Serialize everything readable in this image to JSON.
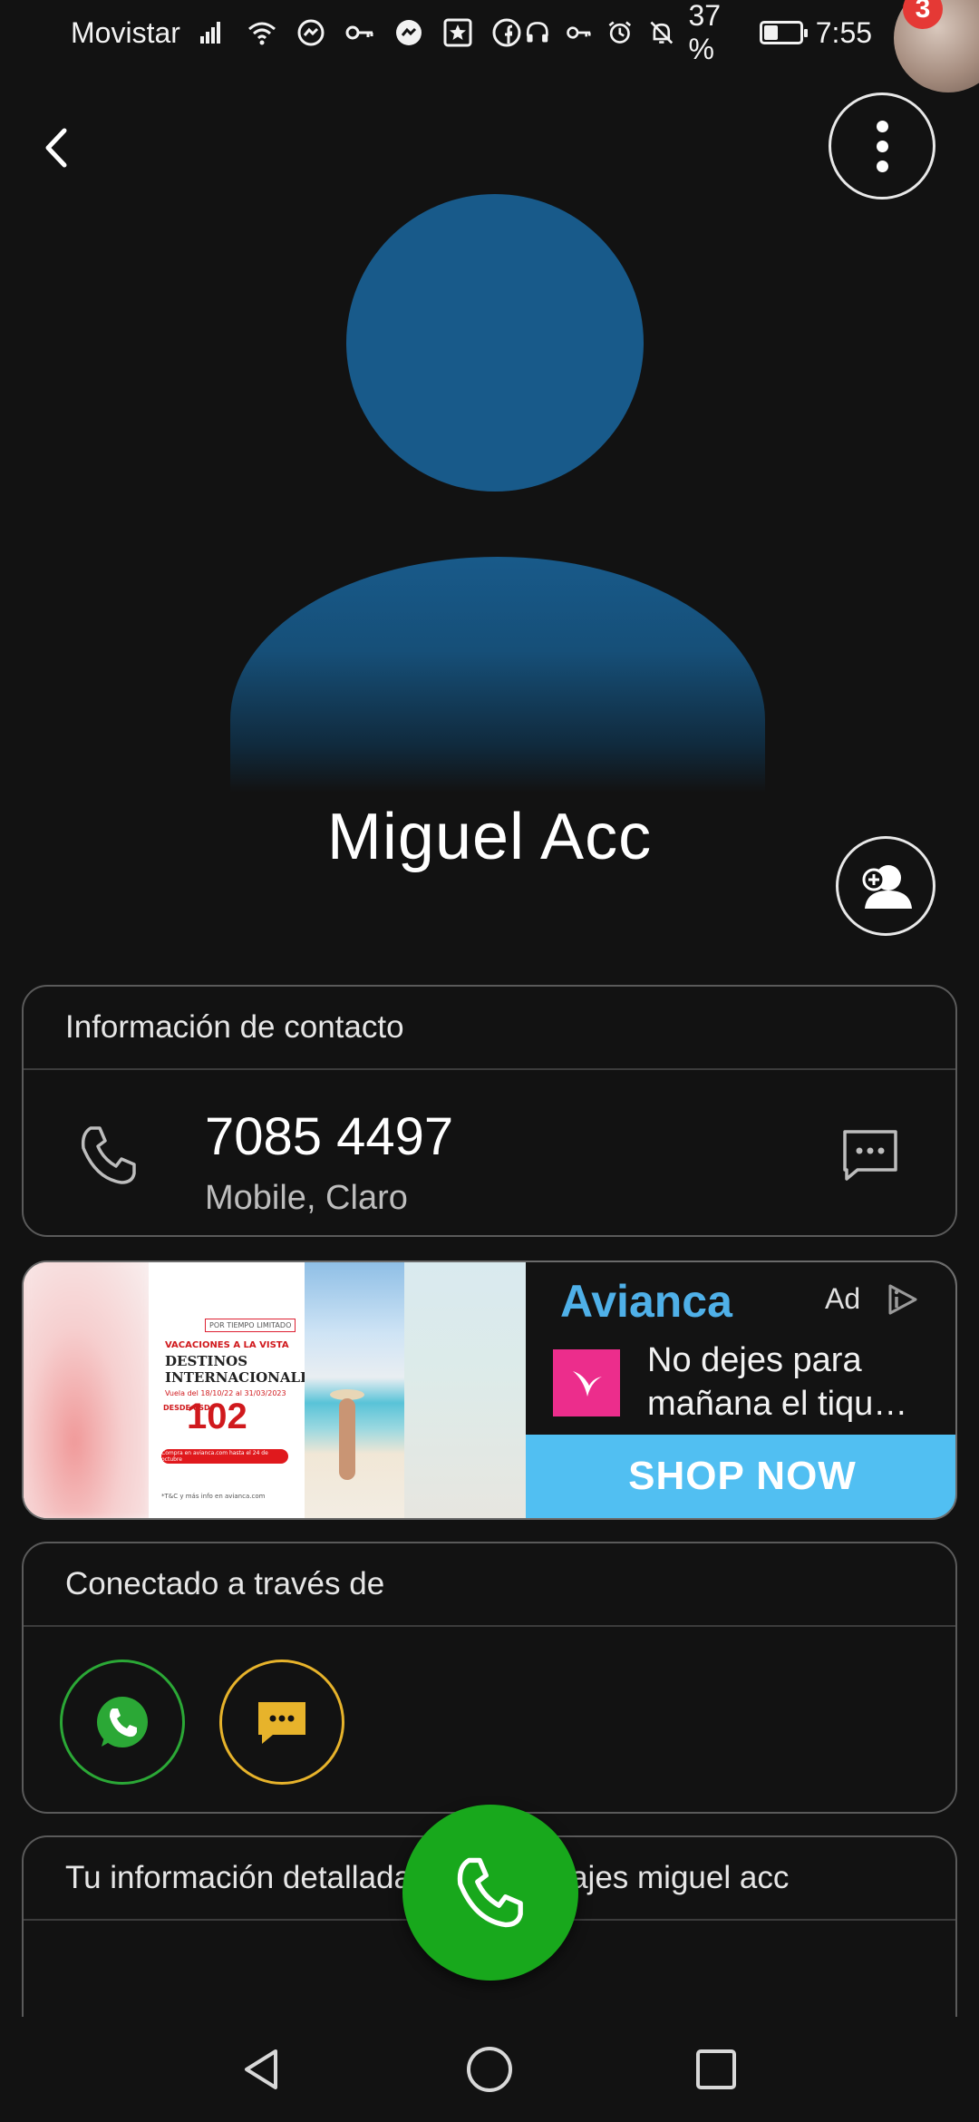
{
  "status_bar": {
    "carrier": "Movistar",
    "battery": "37 %",
    "battery_level": 0.37,
    "time": "7:55",
    "notification_count": "3",
    "icons_left": [
      "signal-icon",
      "wifi-icon",
      "messenger-icon",
      "key-icon",
      "messenger-icon",
      "star-app-icon",
      "facebook-icon"
    ],
    "icons_right": [
      "headset-icon",
      "key-icon",
      "alarm-icon",
      "bell-off-icon",
      "battery-icon"
    ]
  },
  "header": {
    "back_icon": "chevron-left-icon",
    "more_icon": "more-vertical-icon"
  },
  "contact": {
    "name": "Miguel Acc",
    "avatar_color": "#185a8a",
    "add_icon": "add-contact-icon"
  },
  "contact_info": {
    "title": "Información de contacto",
    "number": "7085 4497",
    "subtitle": "Mobile, Claro"
  },
  "ad": {
    "brand": "Avianca",
    "label": "Ad",
    "text_line1": "No dejes para",
    "text_line2": "mañana el tiqu…",
    "cta": "SHOP NOW",
    "cta_color": "#51bff2",
    "brand_color": "#4fb0e8",
    "poster": {
      "tag": "POR TIEMPO LIMITADO",
      "line1": "VACACIONES A LA VISTA",
      "line2": "DESTINOS",
      "line3": "INTERNACIONALES",
      "dates": "Vuela del 18/10/22 al 31/03/2023",
      "desde": "DESDE USD",
      "price": "102",
      "button": "Compra en avianca.com hasta el 24 de octubre",
      "fine": "*T&C y más info en avianca.com"
    }
  },
  "connected": {
    "title": "Conectado a través de",
    "apps": [
      {
        "name": "WhatsApp",
        "color": "#2ba836"
      },
      {
        "name": "Messages",
        "color": "#e7b32b"
      }
    ]
  },
  "details": {
    "title": "Tu información detallada de porcentajes miguel acc"
  },
  "fab": {
    "icon": "phone-icon",
    "color": "#18a81c"
  },
  "nav": {
    "icons": [
      "back-triangle-icon",
      "home-circle-icon",
      "recents-square-icon"
    ]
  }
}
